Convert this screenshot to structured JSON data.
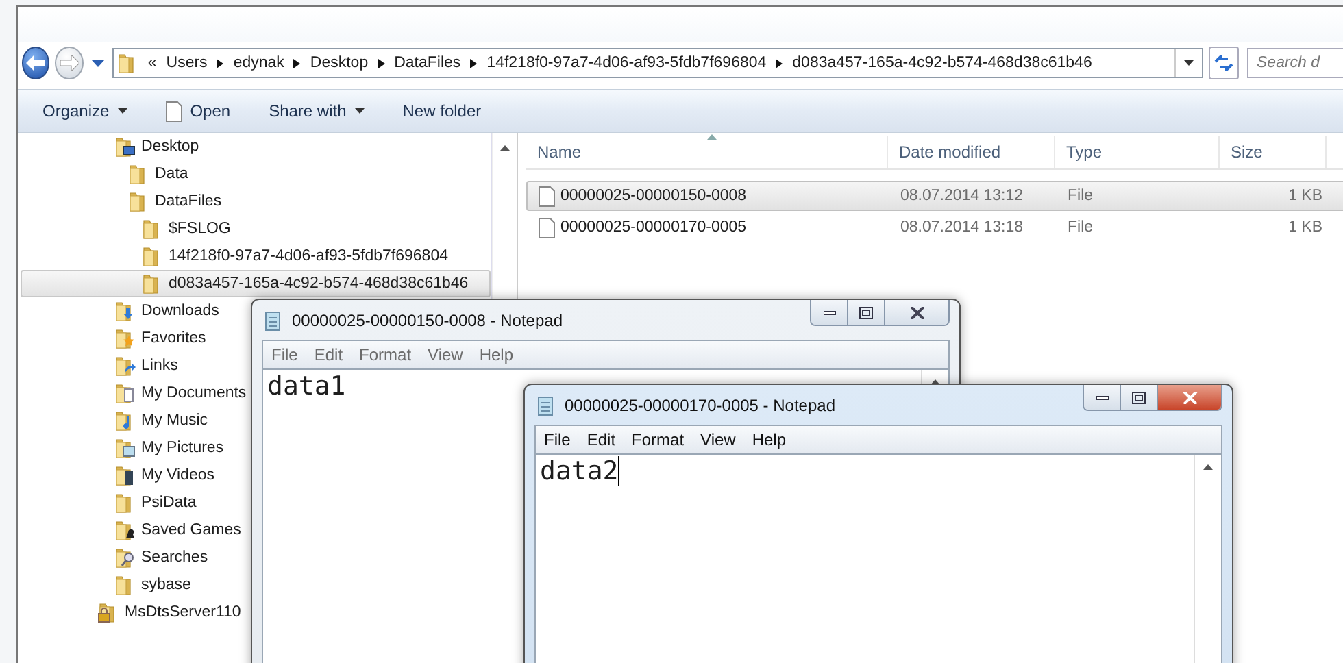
{
  "explorer": {
    "address": {
      "overflow_mark": "«",
      "crumbs": [
        "Users",
        "edynak",
        "Desktop",
        "DataFiles",
        "14f218f0-97a7-4d06-af93-5fdb7f696804",
        "d083a457-165a-4c92-b574-468d38c61b46"
      ]
    },
    "search": {
      "placeholder": "Search d"
    },
    "toolbar": [
      {
        "label": "Organize",
        "kind": "menu"
      },
      {
        "label": "Open",
        "kind": "open"
      },
      {
        "label": "Share with",
        "kind": "menu"
      },
      {
        "label": "New folder",
        "kind": "plain"
      }
    ],
    "nav_tree": {
      "items": [
        {
          "label": "Desktop",
          "kind": "desktop",
          "selected": false,
          "children": [
            {
              "label": "Data",
              "kind": "folder",
              "selected": false
            },
            {
              "label": "DataFiles",
              "kind": "folder",
              "selected": false,
              "children": [
                {
                  "label": "$FSLOG",
                  "kind": "folder",
                  "selected": false
                },
                {
                  "label": "14f218f0-97a7-4d06-af93-5fdb7f696804",
                  "kind": "folder",
                  "selected": false
                },
                {
                  "label": "d083a457-165a-4c92-b574-468d38c61b46",
                  "kind": "folder",
                  "selected": true
                }
              ]
            }
          ]
        },
        {
          "label": "Downloads",
          "kind": "downloads",
          "selected": false
        },
        {
          "label": "Favorites",
          "kind": "favorites",
          "selected": false
        },
        {
          "label": "Links",
          "kind": "links",
          "selected": false
        },
        {
          "label": "My Documents",
          "kind": "documents",
          "selected": false
        },
        {
          "label": "My Music",
          "kind": "music",
          "selected": false
        },
        {
          "label": "My Pictures",
          "kind": "pictures",
          "selected": false
        },
        {
          "label": "My Videos",
          "kind": "videos",
          "selected": false
        },
        {
          "label": "PsiData",
          "kind": "folder",
          "selected": false
        },
        {
          "label": "Saved Games",
          "kind": "games",
          "selected": false
        },
        {
          "label": "Searches",
          "kind": "searches",
          "selected": false
        },
        {
          "label": "sybase",
          "kind": "folder",
          "selected": false
        }
      ],
      "outer_items": [
        {
          "label": "MsDtsServer110",
          "kind": "locked",
          "selected": false
        }
      ]
    },
    "file_list": {
      "columns": [
        {
          "label": "Name",
          "sorted": true
        },
        {
          "label": "Date modified",
          "sorted": false
        },
        {
          "label": "Type",
          "sorted": false
        },
        {
          "label": "Size",
          "sorted": false
        }
      ],
      "rows": [
        {
          "name": "00000025-00000150-0008",
          "date": "08.07.2014 13:12",
          "type": "File",
          "size": "1 KB",
          "selected": true
        },
        {
          "name": "00000025-00000170-0005",
          "date": "08.07.2014 13:18",
          "type": "File",
          "size": "1 KB",
          "selected": false
        }
      ]
    }
  },
  "notepads": [
    {
      "title": "00000025-00000150-0008 - Notepad",
      "active": false,
      "menu": [
        "File",
        "Edit",
        "Format",
        "View",
        "Help"
      ],
      "text": "data1",
      "caret": false
    },
    {
      "title": "00000025-00000170-0005 - Notepad",
      "active": true,
      "menu": [
        "File",
        "Edit",
        "Format",
        "View",
        "Help"
      ],
      "text": "data2",
      "caret": true
    }
  ]
}
